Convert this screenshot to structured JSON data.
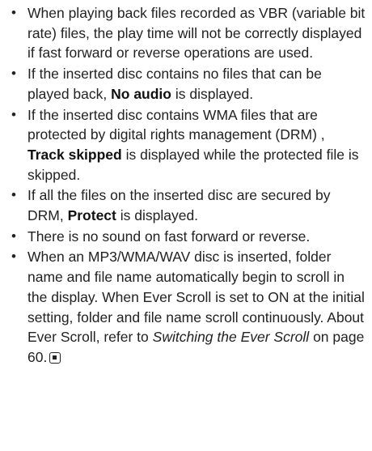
{
  "bullet_char": "•",
  "items": [
    {
      "text": "When playing back files recorded as VBR (variable bit rate) files, the play time will not be correctly displayed if fast forward or reverse operations are used."
    },
    {
      "pre": "If the inserted disc contains no files that can be played back, ",
      "bold": "No audio",
      "post": " is displayed."
    },
    {
      "pre": "If the inserted disc contains WMA files that are protected by digital rights management (DRM) , ",
      "bold": "Track skipped",
      "post": " is displayed while the protected file is skipped."
    },
    {
      "pre": "If all the files on the inserted disc are secured by DRM, ",
      "bold": "Protect",
      "post": " is displayed."
    },
    {
      "text": "There is no sound on fast forward or reverse."
    },
    {
      "pre": "When an MP3/WMA/WAV disc is inserted, folder name and file name automatically begin to scroll in the display. When Ever Scroll is set to ON at the initial setting, folder and file name scroll continuously. About Ever Scroll, refer to ",
      "italic": "Switching the Ever Scroll",
      "post": " on page 60."
    }
  ]
}
